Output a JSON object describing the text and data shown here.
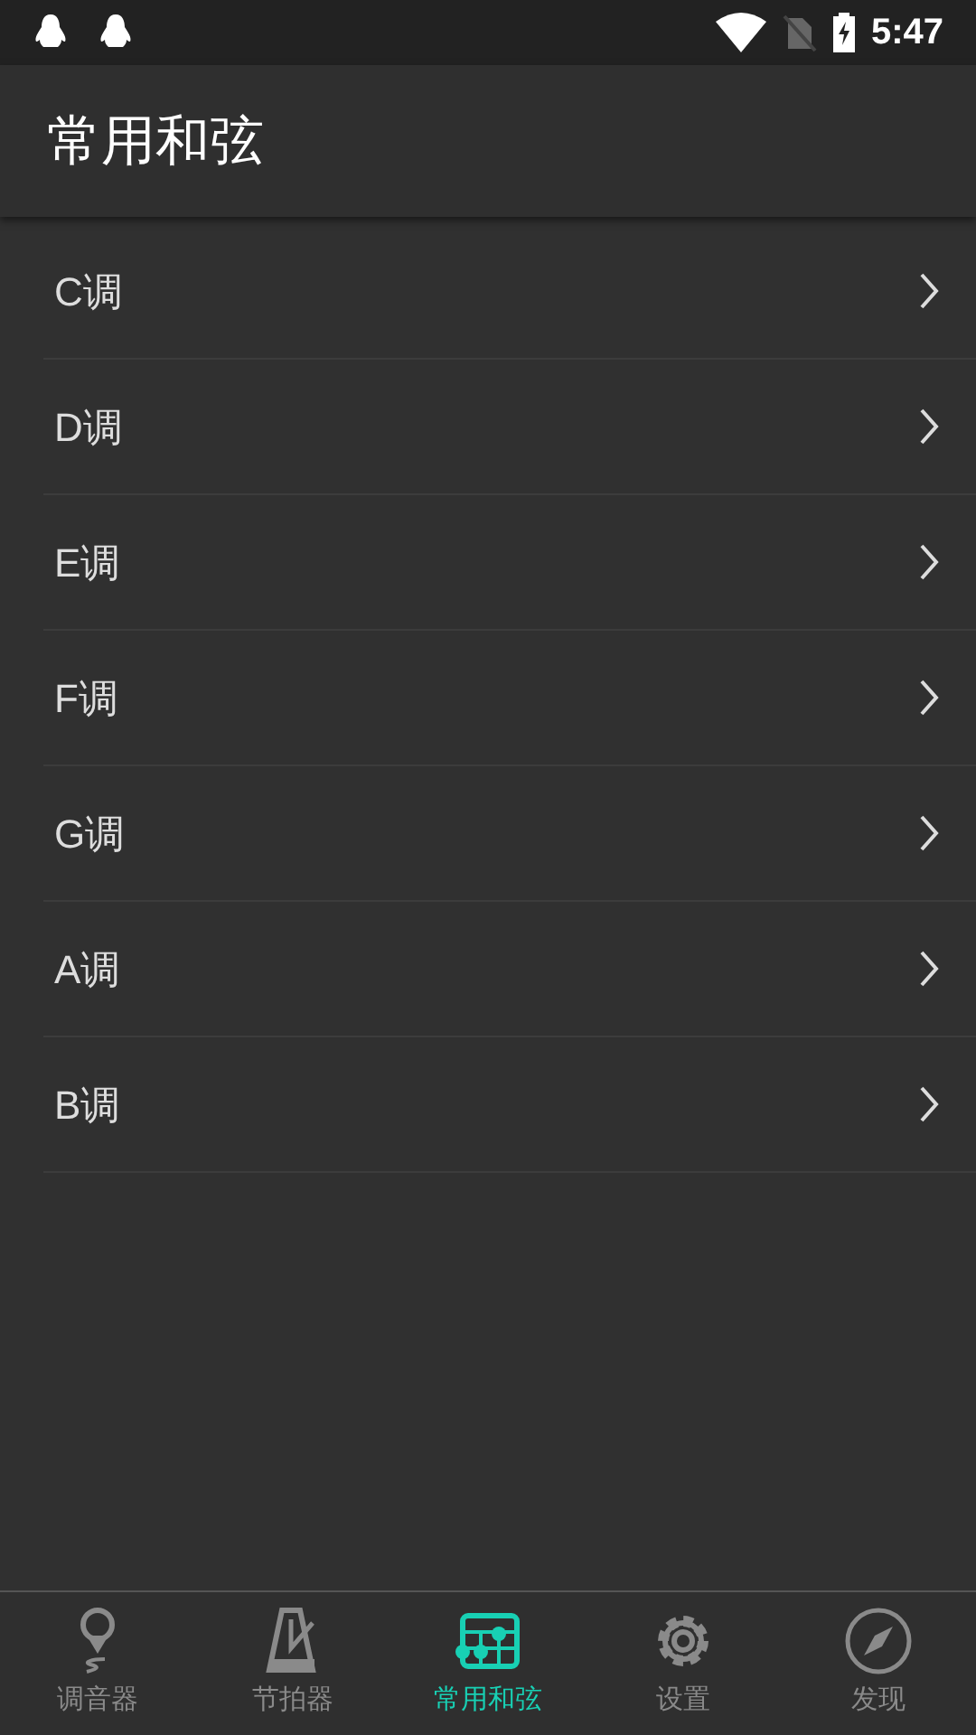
{
  "status_bar": {
    "time": "5:47"
  },
  "app_bar": {
    "title": "常用和弦"
  },
  "keys": [
    {
      "label": "C调"
    },
    {
      "label": "D调"
    },
    {
      "label": "E调"
    },
    {
      "label": "F调"
    },
    {
      "label": "G调"
    },
    {
      "label": "A调"
    },
    {
      "label": "B调"
    }
  ],
  "bottom_nav": [
    {
      "kind": "tuner",
      "label": "调音器",
      "selected": false
    },
    {
      "kind": "metronome",
      "label": "节拍器",
      "selected": false
    },
    {
      "kind": "chords",
      "label": "常用和弦",
      "selected": true
    },
    {
      "kind": "settings",
      "label": "设置",
      "selected": false
    },
    {
      "kind": "discover",
      "label": "发现",
      "selected": false
    }
  ]
}
